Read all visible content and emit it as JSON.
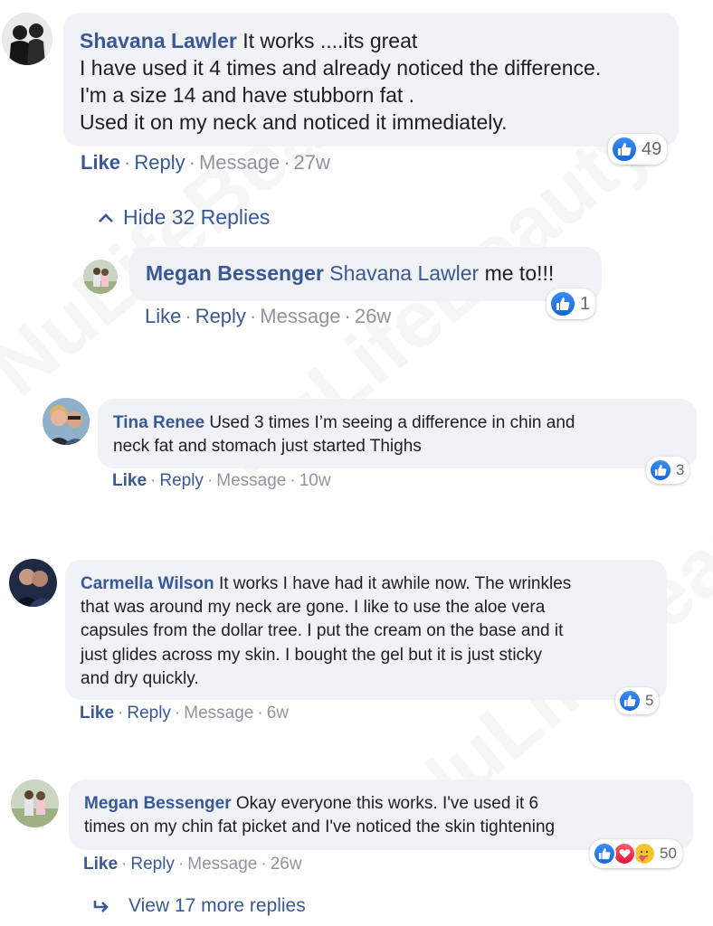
{
  "watermark": "NuLifeBeauty",
  "comments": [
    {
      "author": "Shavana Lawler",
      "text_lines": [
        "It works ....its great",
        "I have used it 4 times and already noticed the difference.",
        "I'm a size 14 and have stubborn fat .",
        "Used it on my neck and noticed it immediately."
      ],
      "like": "Like",
      "reply": "Reply",
      "message": "Message",
      "time": "27w",
      "reactions": {
        "icons": [
          "like-icon"
        ],
        "count": "49"
      }
    },
    {
      "author": "Megan Bessenger",
      "mention": "Shavana Lawler",
      "text": "me to!!!",
      "like": "Like",
      "reply": "Reply",
      "message": "Message",
      "time": "26w",
      "reactions": {
        "icons": [
          "like-icon"
        ],
        "count": "1"
      }
    },
    {
      "author": "Tina Renee",
      "text_lines": [
        "Used 3 times I’m seeing a difference in chin and",
        "neck fat and stomach just started Thighs"
      ],
      "like": "Like",
      "reply": "Reply",
      "message": "Message",
      "time": "10w",
      "reactions": {
        "icons": [
          "like-icon"
        ],
        "count": "3"
      }
    },
    {
      "author": "Carmella Wilson",
      "text_lines": [
        "It works I have had it awhile now. The wrinkles",
        "that was around my neck are gone. I like to use the aloe vera",
        "capsules from the dollar tree. I put the cream on the base and it",
        "just glides across my skin. I bought the gel but it is just sticky",
        "and dry quickly."
      ],
      "like": "Like",
      "reply": "Reply",
      "message": "Message",
      "time": "6w",
      "reactions": {
        "icons": [
          "like-icon"
        ],
        "count": "5"
      }
    },
    {
      "author": "Megan Bessenger",
      "text_lines": [
        "Okay everyone this works. I've used it 6",
        "times on my chin fat picket and I've noticed the skin tightening"
      ],
      "like": "Like",
      "reply": "Reply",
      "message": "Message",
      "time": "26w",
      "reactions": {
        "icons": [
          "like-icon",
          "heart-icon",
          "care-icon"
        ],
        "count": "50"
      }
    }
  ],
  "hide_replies": "Hide 32 Replies",
  "view_more": "View 17 more replies",
  "colors": {
    "link": "#385898",
    "bubble": "#f0f2f5",
    "meta": "#90949c",
    "like_blue": "#1877f2"
  }
}
